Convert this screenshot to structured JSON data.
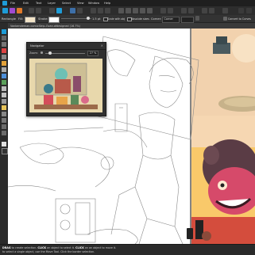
{
  "app": {
    "name": "Affinity Designer"
  },
  "menu": [
    "File",
    "Edit",
    "Text",
    "Layer",
    "Select",
    "View",
    "Window",
    "Help"
  ],
  "context_toolbar": {
    "shape_label": "Rectangle",
    "fill_label": "Fill:",
    "stroke_label": "Stroke:",
    "stroke_width": "1.5 pt",
    "scale_with_object": "Scale with obj",
    "absolute_corner_sizes": "Absolute sizes",
    "corner_label": "Corner:",
    "corner_value": "Corner",
    "convert_label": "Convert to Curves",
    "fill_color": "#f2e4c8",
    "stroke_color": "#ffffff"
  },
  "document": {
    "tab_title": "Vanbendeman.comicStrip-Ovan.afdesigned (16.7%)"
  },
  "navigator": {
    "title": "Navigator",
    "zoom_label": "Zoom:",
    "zoom_value": "27 %"
  },
  "status": {
    "bold1": "DRAG",
    "text1": " to create selection. ",
    "bold2": "CLICK",
    "text2": " an object to select it. ",
    "bold3": "CLICK",
    "text3": " on an object to move it. ",
    "line2": "to select a single object, use the Move Tool. Click the border selection."
  },
  "accent_color": "#1e9cd7"
}
